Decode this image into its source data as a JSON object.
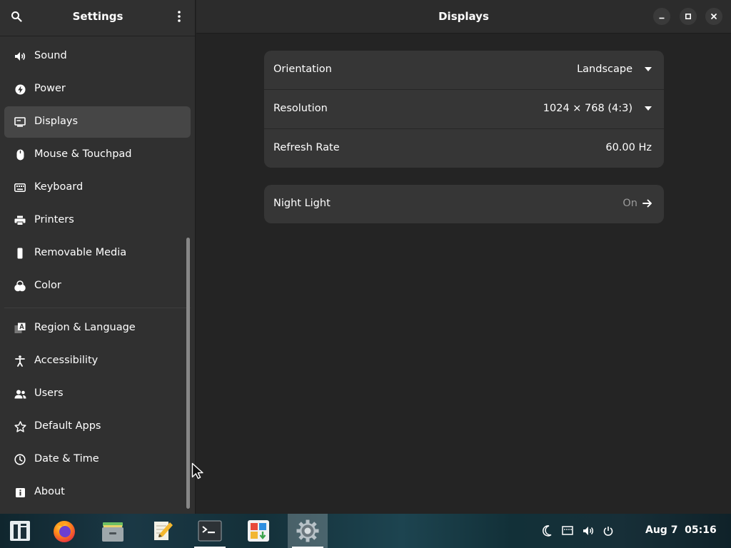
{
  "sidebar": {
    "title": "Settings",
    "search_icon": "search-icon",
    "menu_icon": "kebab-menu-icon",
    "items": [
      {
        "label": "Sound",
        "icon": "speaker-icon"
      },
      {
        "label": "Power",
        "icon": "power-bolt-icon"
      },
      {
        "label": "Displays",
        "icon": "display-icon",
        "active": true
      },
      {
        "label": "Mouse & Touchpad",
        "icon": "mouse-icon"
      },
      {
        "label": "Keyboard",
        "icon": "keyboard-icon"
      },
      {
        "label": "Printers",
        "icon": "printer-icon"
      },
      {
        "label": "Removable Media",
        "icon": "usb-drive-icon"
      },
      {
        "label": "Color",
        "icon": "color-circles-icon"
      },
      {
        "label": "Region & Language",
        "icon": "region-language-icon"
      },
      {
        "label": "Accessibility",
        "icon": "accessibility-icon"
      },
      {
        "label": "Users",
        "icon": "users-icon"
      },
      {
        "label": "Default Apps",
        "icon": "star-icon"
      },
      {
        "label": "Date & Time",
        "icon": "clock-icon"
      },
      {
        "label": "About",
        "icon": "info-icon"
      }
    ]
  },
  "content": {
    "title": "Displays",
    "window_buttons": [
      "minimize-icon",
      "maximize-icon",
      "close-icon"
    ],
    "display_rows": [
      {
        "label": "Orientation",
        "value": "Landscape",
        "type": "dropdown"
      },
      {
        "label": "Resolution",
        "value": "1024 × 768 (4:3)",
        "type": "dropdown"
      },
      {
        "label": "Refresh Rate",
        "value": "60.00 Hz",
        "type": "static"
      }
    ],
    "night_light": {
      "label": "Night Light",
      "value": "On",
      "icon": "arrow-right-icon"
    }
  },
  "taskbar": {
    "apps": [
      {
        "name": "app-launcher",
        "icon": "zorin-logo-icon"
      },
      {
        "name": "firefox",
        "icon": "firefox-icon"
      },
      {
        "name": "files",
        "icon": "file-cabinet-icon"
      },
      {
        "name": "text-editor",
        "icon": "text-editor-icon"
      },
      {
        "name": "terminal",
        "icon": "terminal-icon"
      },
      {
        "name": "software",
        "icon": "software-store-icon"
      },
      {
        "name": "settings",
        "icon": "settings-gear-icon",
        "active": true
      }
    ],
    "tray": [
      "night-mode-icon",
      "network-icon",
      "volume-icon",
      "power-icon"
    ],
    "clock": "Aug 7  05:16"
  },
  "colors": {
    "sidebar_bg": "#303030",
    "content_bg": "#242424",
    "card_bg": "#363636",
    "active_item_bg": "#464646",
    "dim_text": "#9a9a9a"
  }
}
